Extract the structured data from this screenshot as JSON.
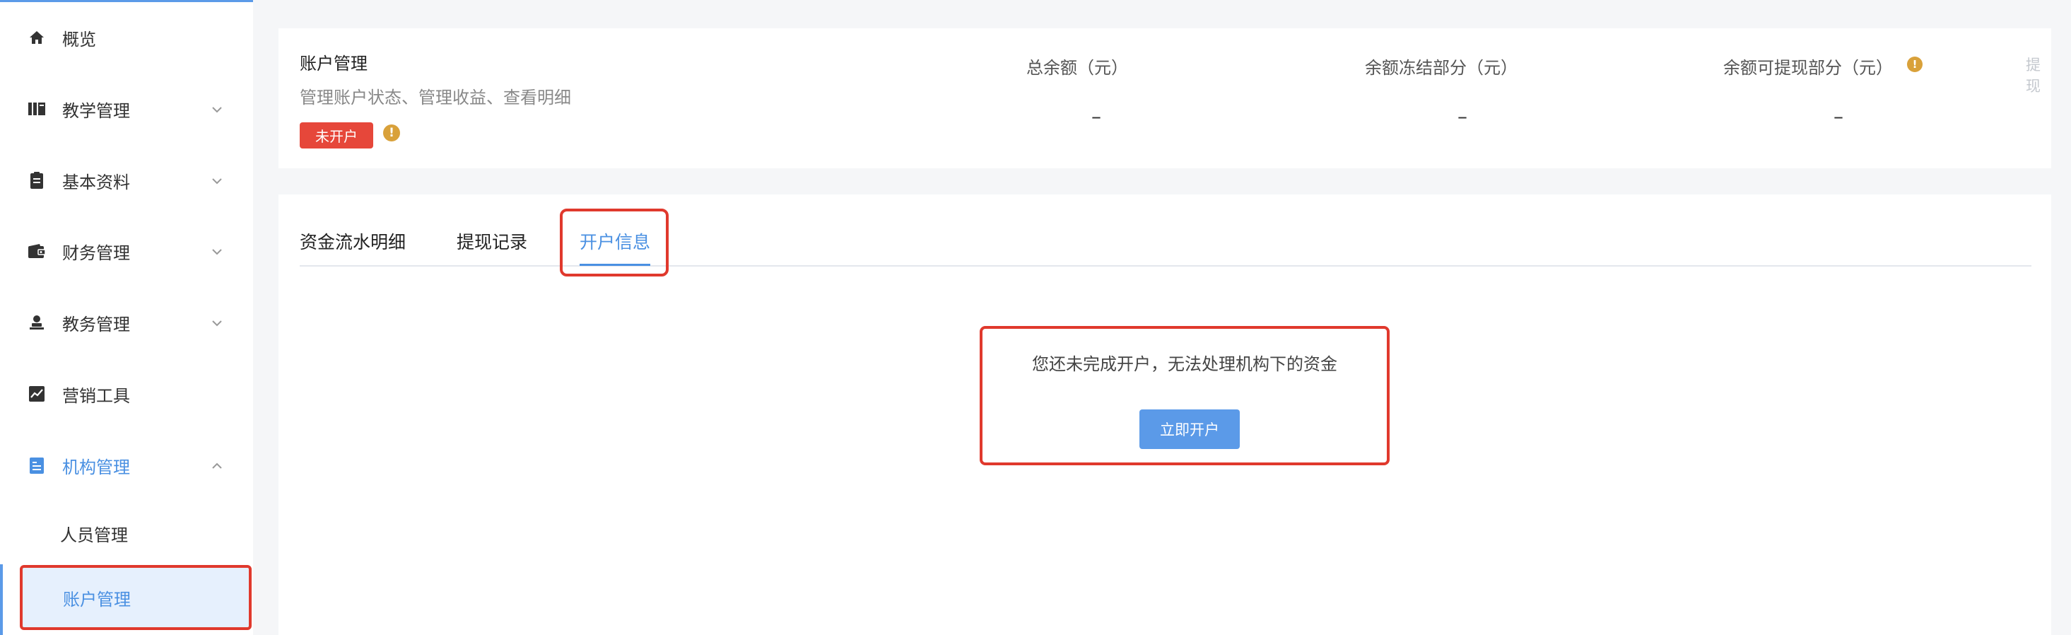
{
  "sidebar": {
    "items": [
      {
        "label": "概览",
        "icon": "home-icon"
      },
      {
        "label": "教学管理",
        "icon": "book-icon"
      },
      {
        "label": "基本资料",
        "icon": "clipboard-icon"
      },
      {
        "label": "财务管理",
        "icon": "wallet-icon"
      },
      {
        "label": "教务管理",
        "icon": "user-stamp-icon"
      },
      {
        "label": "营销工具",
        "icon": "chart-icon"
      },
      {
        "label": "机构管理",
        "icon": "building-doc-icon"
      }
    ],
    "subitems": [
      {
        "label": "人员管理"
      },
      {
        "label": "账户管理"
      }
    ]
  },
  "account": {
    "title": "账户管理",
    "subtitle": "管理账户状态、管理收益、查看明细",
    "status_badge": "未开户",
    "stats": [
      {
        "label": "总余额（元）",
        "value": "–"
      },
      {
        "label": "余额冻结部分（元）",
        "value": "–"
      },
      {
        "label": "余额可提现部分（元）",
        "value": "–"
      }
    ],
    "withdraw_label": "提现"
  },
  "tabs": [
    {
      "label": "资金流水明细"
    },
    {
      "label": "提现记录"
    },
    {
      "label": "开户信息"
    }
  ],
  "empty_state": {
    "message": "您还未完成开户，无法处理机构下的资金",
    "button_label": "立即开户"
  },
  "colors": {
    "accent": "#4a90e2",
    "badge_red": "#e6473a",
    "warning": "#d9a13a",
    "highlight_red": "#e0392d"
  }
}
